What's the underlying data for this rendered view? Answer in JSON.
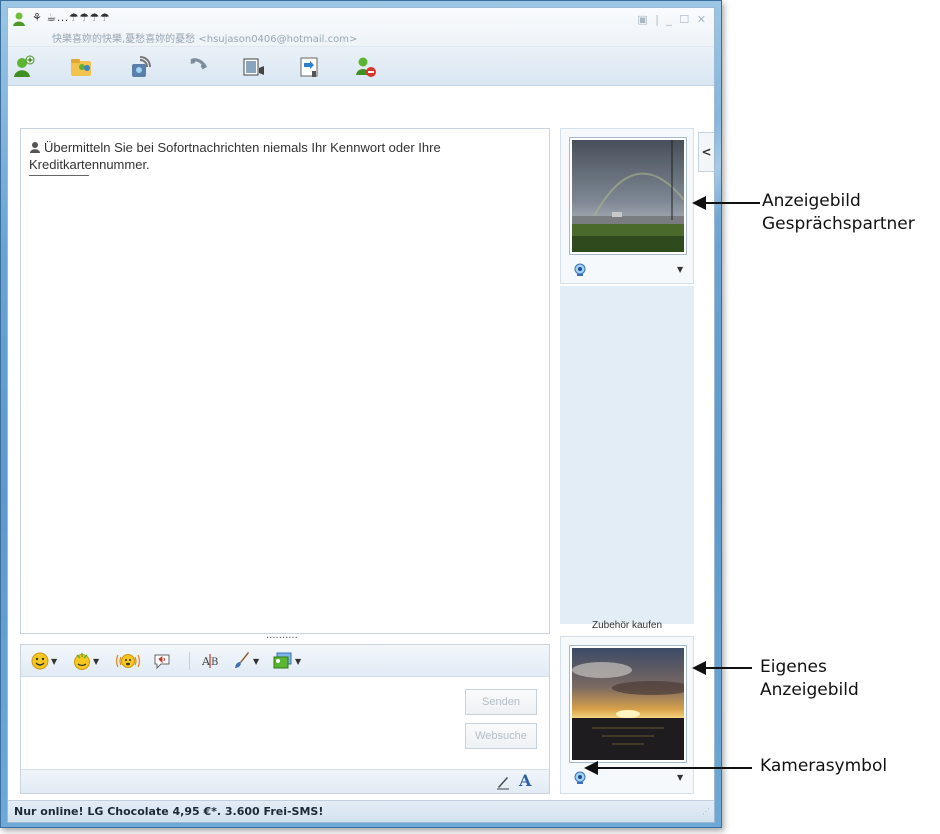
{
  "window": {
    "contact_name": "⚘ ☕...☂☂☂☂",
    "contact_subtitle": "快樂喜妳的快樂,憂愁喜妳的憂愁 <hsujason0406@hotmail.com>",
    "controls": "▣ | _ ☐ ✕"
  },
  "toolbar": {
    "items": [
      "add-contact-icon",
      "shared-folders-icon",
      "webcam-share-icon",
      "call-icon",
      "video-icon",
      "games-icon",
      "block-icon"
    ]
  },
  "conversation": {
    "warning": "Übermitteln Sie bei Sofortnachrichten niemals Ihr Kennwort oder Ihre Kreditkartennummer.",
    "grip": "··········"
  },
  "input": {
    "message_value": "",
    "send_label": "Senden",
    "websearch_label": "Websuche"
  },
  "side": {
    "collapse_label": "<",
    "accessories_label": "Zubehör kaufen"
  },
  "status": {
    "ad_text": "Nur online! LG Chocolate 4,95 €*. 3.600 Frei-SMS!"
  },
  "annotations": {
    "partner_picture": [
      "Anzeigebild",
      "Gesprächspartner"
    ],
    "own_picture": [
      "Eigenes",
      "Anzeigebild"
    ],
    "camera_symbol": "Kamerasymbol"
  }
}
